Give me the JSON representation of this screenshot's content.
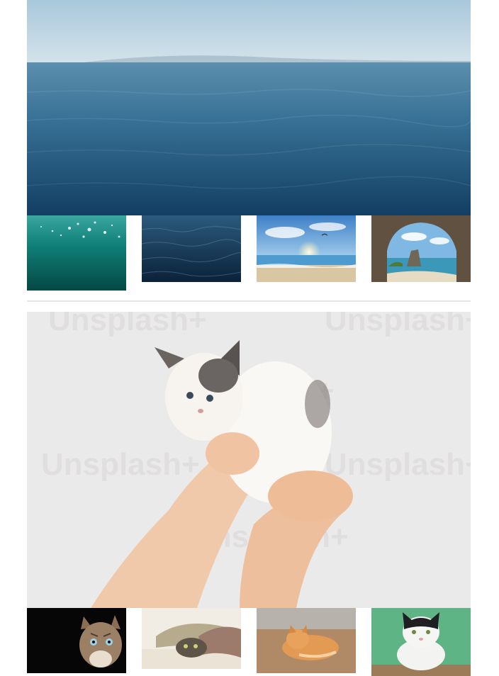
{
  "galleries": [
    {
      "id": "ocean",
      "hero": {
        "icon": "ocean-horizon-photo"
      },
      "thumbnails": [
        {
          "icon": "underwater-bubbles-photo"
        },
        {
          "icon": "dark-sea-waves-photo"
        },
        {
          "icon": "sunny-beach-photo"
        },
        {
          "icon": "sea-cave-arch-photo"
        }
      ]
    },
    {
      "id": "cats",
      "hero": {
        "icon": "kitten-held-in-hands-photo",
        "watermark": "Unsplash+"
      },
      "thumbnails": [
        {
          "icon": "tabby-cat-portrait-photo"
        },
        {
          "icon": "cat-under-blanket-photo"
        },
        {
          "icon": "ginger-cat-lying-photo"
        },
        {
          "icon": "black-white-cat-photo"
        }
      ]
    }
  ],
  "colors": {
    "sky": "#b9d2e2",
    "sea": "#2f6a8c",
    "deep_sea": "#0f3552",
    "teal": "#0f7f78",
    "wall": "#ebeaea",
    "divider": "#e6e6e6"
  }
}
